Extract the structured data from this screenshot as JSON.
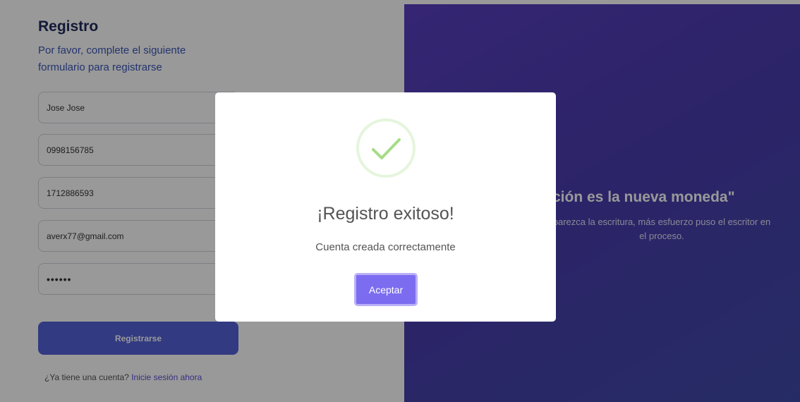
{
  "form": {
    "title": "Registro",
    "subtitle": "Por favor, complete el siguiente formulario para registrarse",
    "fields": {
      "name": "Jose Jose",
      "phone": "0998156785",
      "id_number": "1712886593",
      "email": "averx77@gmail.com",
      "password": "••••••"
    },
    "register_label": "Registrarse",
    "login_prompt": "¿Ya tiene una cuenta?",
    "login_link": "Inicie sesión ahora"
  },
  "promo": {
    "quote": "ción es la nueva moneda\"",
    "caption": "parezca la escritura, más esfuerzo puso el escritor en el proceso."
  },
  "modal": {
    "icon": "check-icon",
    "title": "¡Registro exitoso!",
    "message": "Cuenta creada correctamente",
    "confirm_label": "Aceptar"
  },
  "colors": {
    "primary": "#5462d8",
    "modal_button": "#7c6cf0",
    "success": "#a5dc86",
    "promo_gradient_start": "#5a3fc0",
    "promo_gradient_end": "#3f4aa8"
  }
}
